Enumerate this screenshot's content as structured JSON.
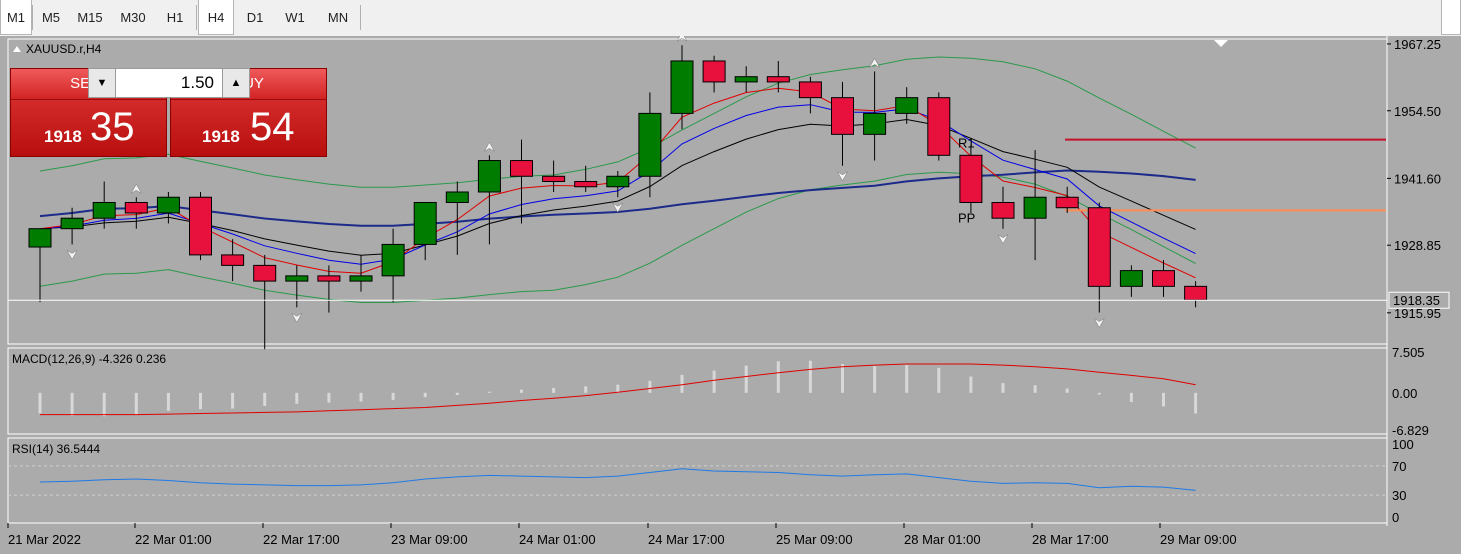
{
  "toolbar": {
    "timeframes": [
      "M1",
      "M5",
      "M15",
      "M30",
      "H1",
      "H4",
      "D1",
      "W1",
      "MN"
    ],
    "active": "H4"
  },
  "chart": {
    "symbol_label": "XAUUSD.r,H4",
    "price_ticks": [
      "1967.25",
      "1954.50",
      "1941.60",
      "1928.85",
      "1915.95"
    ],
    "current_price_label": "1918.35",
    "pivot_labels": {
      "r1": "R1",
      "pp": "PP"
    },
    "time_labels": [
      "21 Mar 2022",
      "22 Mar 01:00",
      "22 Mar 17:00",
      "23 Mar 09:00",
      "24 Mar 01:00",
      "24 Mar 17:00",
      "25 Mar 09:00",
      "28 Mar 01:00",
      "28 Mar 17:00",
      "29 Mar 09:00"
    ],
    "colors": {
      "bull": "#007d00",
      "bear": "#e8103c",
      "bg": "#ababab",
      "ma_fast": "#e00000",
      "ma_mid": "#0000e8",
      "ma_slow": "#000000",
      "ma_long": "#1c2a8a",
      "bands": "#2a9a4a",
      "r1": "#c4102a",
      "pp": "#ff8c50"
    }
  },
  "trade_panel": {
    "sell_label": "SELL",
    "buy_label": "BUY",
    "lot": "1.50",
    "sell_price_small": "1918",
    "sell_price_big": "35",
    "buy_price_small": "1918",
    "buy_price_big": "54",
    "lot_down_icon": "triangle-down-icon",
    "lot_up_icon": "triangle-up-icon"
  },
  "macd": {
    "label": "MACD(12,26,9) -4.326 0.236",
    "ticks": [
      "7.505",
      "0.00",
      "-6.829"
    ]
  },
  "rsi": {
    "label": "RSI(14) 36.5444",
    "ticks": [
      "100",
      "70",
      "30",
      "0"
    ]
  },
  "chart_data": {
    "type": "candlestick",
    "candles": [
      {
        "o": 1928.5,
        "h": 1932,
        "l": 1918,
        "c": 1932
      },
      {
        "o": 1932,
        "h": 1936,
        "l": 1929,
        "c": 1934
      },
      {
        "o": 1934,
        "h": 1941,
        "l": 1932,
        "c": 1937
      },
      {
        "o": 1937,
        "h": 1938,
        "l": 1932,
        "c": 1935
      },
      {
        "o": 1935,
        "h": 1939,
        "l": 1933,
        "c": 1938
      },
      {
        "o": 1938,
        "h": 1939,
        "l": 1926,
        "c": 1927
      },
      {
        "o": 1927,
        "h": 1930,
        "l": 1922,
        "c": 1925
      },
      {
        "o": 1925,
        "h": 1927,
        "l": 1909,
        "c": 1922
      },
      {
        "o": 1922,
        "h": 1925,
        "l": 1917,
        "c": 1923
      },
      {
        "o": 1923,
        "h": 1925,
        "l": 1916,
        "c": 1922
      },
      {
        "o": 1922,
        "h": 1927,
        "l": 1920,
        "c": 1923
      },
      {
        "o": 1923,
        "h": 1932,
        "l": 1918,
        "c": 1929
      },
      {
        "o": 1929,
        "h": 1935,
        "l": 1926,
        "c": 1937
      },
      {
        "o": 1937,
        "h": 1941,
        "l": 1927,
        "c": 1939
      },
      {
        "o": 1939,
        "h": 1946,
        "l": 1929,
        "c": 1945
      },
      {
        "o": 1945,
        "h": 1949,
        "l": 1933,
        "c": 1942
      },
      {
        "o": 1942,
        "h": 1945,
        "l": 1939,
        "c": 1941
      },
      {
        "o": 1941,
        "h": 1944,
        "l": 1939,
        "c": 1940
      },
      {
        "o": 1940,
        "h": 1943,
        "l": 1938,
        "c": 1942
      },
      {
        "o": 1942,
        "h": 1958,
        "l": 1938,
        "c": 1954
      },
      {
        "o": 1954,
        "h": 1967,
        "l": 1951,
        "c": 1964
      },
      {
        "o": 1964,
        "h": 1965,
        "l": 1958,
        "c": 1960
      },
      {
        "o": 1960,
        "h": 1963,
        "l": 1958,
        "c": 1961
      },
      {
        "o": 1961,
        "h": 1964,
        "l": 1958,
        "c": 1960
      },
      {
        "o": 1960,
        "h": 1961,
        "l": 1954,
        "c": 1957
      },
      {
        "o": 1957,
        "h": 1960,
        "l": 1944,
        "c": 1950
      },
      {
        "o": 1950,
        "h": 1962,
        "l": 1945,
        "c": 1954
      },
      {
        "o": 1954,
        "h": 1959,
        "l": 1952,
        "c": 1957
      },
      {
        "o": 1957,
        "h": 1958,
        "l": 1945,
        "c": 1946
      },
      {
        "o": 1946,
        "h": 1948,
        "l": 1935,
        "c": 1937
      },
      {
        "o": 1937,
        "h": 1940,
        "l": 1932,
        "c": 1934
      },
      {
        "o": 1934,
        "h": 1947,
        "l": 1926,
        "c": 1938
      },
      {
        "o": 1938,
        "h": 1940,
        "l": 1935,
        "c": 1936
      },
      {
        "o": 1936,
        "h": 1937,
        "l": 1916,
        "c": 1921
      },
      {
        "o": 1921,
        "h": 1925,
        "l": 1919,
        "c": 1924
      },
      {
        "o": 1924,
        "h": 1926,
        "l": 1919,
        "c": 1921
      },
      {
        "o": 1921,
        "h": 1922,
        "l": 1917,
        "c": 1918.4
      }
    ],
    "ylim": [
      1910,
      1968
    ],
    "macd_hist": [
      -3.8,
      -4.2,
      -4.3,
      -4.0,
      -3.3,
      -3.0,
      -2.9,
      -2.4,
      -2.0,
      -1.8,
      -1.6,
      -1.3,
      -0.8,
      -0.4,
      0.2,
      0.6,
      0.9,
      1.2,
      1.5,
      2.2,
      3.3,
      4.1,
      5.0,
      5.8,
      5.9,
      5.3,
      4.9,
      5.1,
      4.6,
      3.0,
      1.8,
      1.4,
      0.8,
      -0.3,
      -1.7,
      -2.5,
      -3.8
    ],
    "macd_signal": [
      -4.0,
      -4.0,
      -4.0,
      -4.0,
      -3.9,
      -3.8,
      -3.7,
      -3.6,
      -3.5,
      -3.3,
      -3.1,
      -2.9,
      -2.7,
      -2.3,
      -1.9,
      -1.4,
      -1.0,
      -0.5,
      0.1,
      0.8,
      1.5,
      2.3,
      3.0,
      3.7,
      4.3,
      4.8,
      5.1,
      5.3,
      5.3,
      5.3,
      5.1,
      4.8,
      4.4,
      3.8,
      3.2,
      2.6,
      1.5
    ],
    "macd_ylim": [
      -6.829,
      7.505
    ],
    "rsi": [
      48,
      49,
      51,
      52,
      50,
      47,
      45,
      44,
      43,
      43,
      44,
      47,
      52,
      55,
      57,
      56,
      55,
      54,
      56,
      61,
      66,
      63,
      62,
      61,
      58,
      56,
      58,
      59,
      54,
      49,
      46,
      47,
      46,
      40,
      42,
      41,
      36.5
    ],
    "rsi_levels": [
      70,
      30
    ],
    "rsi_ylim": [
      0,
      100
    ],
    "grid": false
  }
}
